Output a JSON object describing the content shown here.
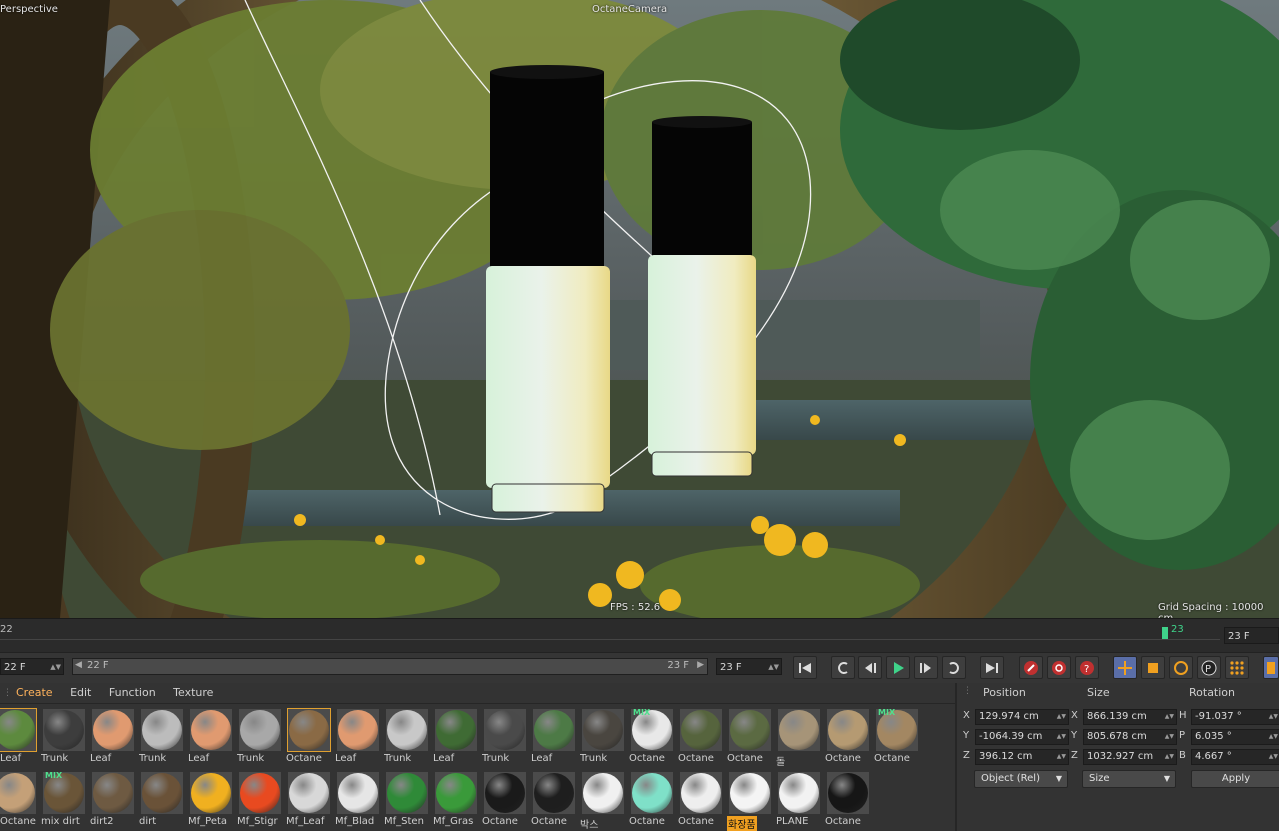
{
  "viewport": {
    "name": "Perspective",
    "camera": "OctaneCamera",
    "fps": "FPS : 52.6",
    "grid_spacing": "Grid Spacing : 10000 cm"
  },
  "timeline": {
    "start_label": "22",
    "marker_label": "23",
    "current_frame": "23 F",
    "playhead_fraction": 0.955
  },
  "transport": {
    "min_frame": "22 F",
    "range_start": "22 F",
    "range_end": "23 F",
    "max_frame": "23 F"
  },
  "materials": {
    "menu": [
      "Create",
      "Edit",
      "Function",
      "Texture"
    ],
    "row1": [
      {
        "label": "Leaf",
        "color": "#5d8a3e",
        "selected": true
      },
      {
        "label": "Trunk",
        "color": "#3d3d3d"
      },
      {
        "label": "Leaf",
        "color": "#e09a70"
      },
      {
        "label": "Trunk",
        "color": "#bcbcbc"
      },
      {
        "label": "Leaf",
        "color": "#e09a70"
      },
      {
        "label": "Trunk",
        "color": "#a8a8a8"
      },
      {
        "label": "Octane",
        "color": "#8a6a45",
        "selected": true
      },
      {
        "label": "Leaf",
        "color": "#e09a70"
      },
      {
        "label": "Trunk",
        "color": "#c8c8c8"
      },
      {
        "label": "Leaf",
        "color": "#3f6b34"
      },
      {
        "label": "Trunk",
        "color": "#4a4a4a"
      },
      {
        "label": "Leaf",
        "color": "#4d7a46"
      },
      {
        "label": "Trunk",
        "color": "#4a4640"
      },
      {
        "label": "Octane",
        "color": "#e8e8e8",
        "mix": "MIX"
      },
      {
        "label": "Octane",
        "color": "#56643d"
      },
      {
        "label": "Octane",
        "color": "#5b6a42"
      },
      {
        "label": "돌",
        "color": "#a69478"
      },
      {
        "label": "Octane",
        "color": "#b59a72"
      },
      {
        "label": "Octane",
        "color": "#a38762",
        "mix": "MIX"
      }
    ],
    "row2": [
      {
        "label": "Octane",
        "color": "#c4a078"
      },
      {
        "label": "mix dirt",
        "color": "#6a5538",
        "mix": "MIX"
      },
      {
        "label": "dirt2",
        "color": "#6e5a42"
      },
      {
        "label": "dirt",
        "color": "#6a5238"
      },
      {
        "label": "Mf_Peta",
        "color": "#f0b020"
      },
      {
        "label": "Mf_Stigr",
        "color": "#e84a20"
      },
      {
        "label": "Mf_Leaf",
        "color": "#d8d8d8"
      },
      {
        "label": "Mf_Blad",
        "color": "#e6e6e6"
      },
      {
        "label": "Mf_Sten",
        "color": "#2f8a38"
      },
      {
        "label": "Mf_Gras",
        "color": "#3a9a3a"
      },
      {
        "label": "Octane",
        "color": "#1a1a1a"
      },
      {
        "label": "Octane",
        "color": "#1e1e1e"
      },
      {
        "label": "박스",
        "color": "#f0f0f0"
      },
      {
        "label": "Octane",
        "color": "#7fe0c8"
      },
      {
        "label": "Octane",
        "color": "#eeeeee"
      },
      {
        "label": "화장품",
        "color": "#f4f4f4",
        "highlight": true
      },
      {
        "label": "PLANE",
        "color": "#f2f2f2"
      },
      {
        "label": "Octane",
        "color": "#161616"
      }
    ]
  },
  "attributes": {
    "headers": {
      "position": "Position",
      "size": "Size",
      "rotation": "Rotation"
    },
    "rows": [
      {
        "pos_axis": "X",
        "pos": "129.974 cm",
        "size_axis": "X",
        "size": "866.139 cm",
        "rot_axis": "H",
        "rot": "-91.037 °"
      },
      {
        "pos_axis": "Y",
        "pos": "-1064.39 cm",
        "size_axis": "Y",
        "size": "805.678 cm",
        "rot_axis": "P",
        "rot": "6.035 °"
      },
      {
        "pos_axis": "Z",
        "pos": "396.12 cm",
        "size_axis": "Z",
        "size": "1032.927 cm",
        "rot_axis": "B",
        "rot": "4.667 °"
      }
    ],
    "mode_dropdown": "Object (Rel)",
    "size_dropdown": "Size",
    "apply_label": "Apply"
  },
  "colors": {
    "accent": "#ffb35c",
    "timeline_marker": "#3fd38a",
    "record_red": "#c03030",
    "tool_blue": "#6f8ed8"
  }
}
